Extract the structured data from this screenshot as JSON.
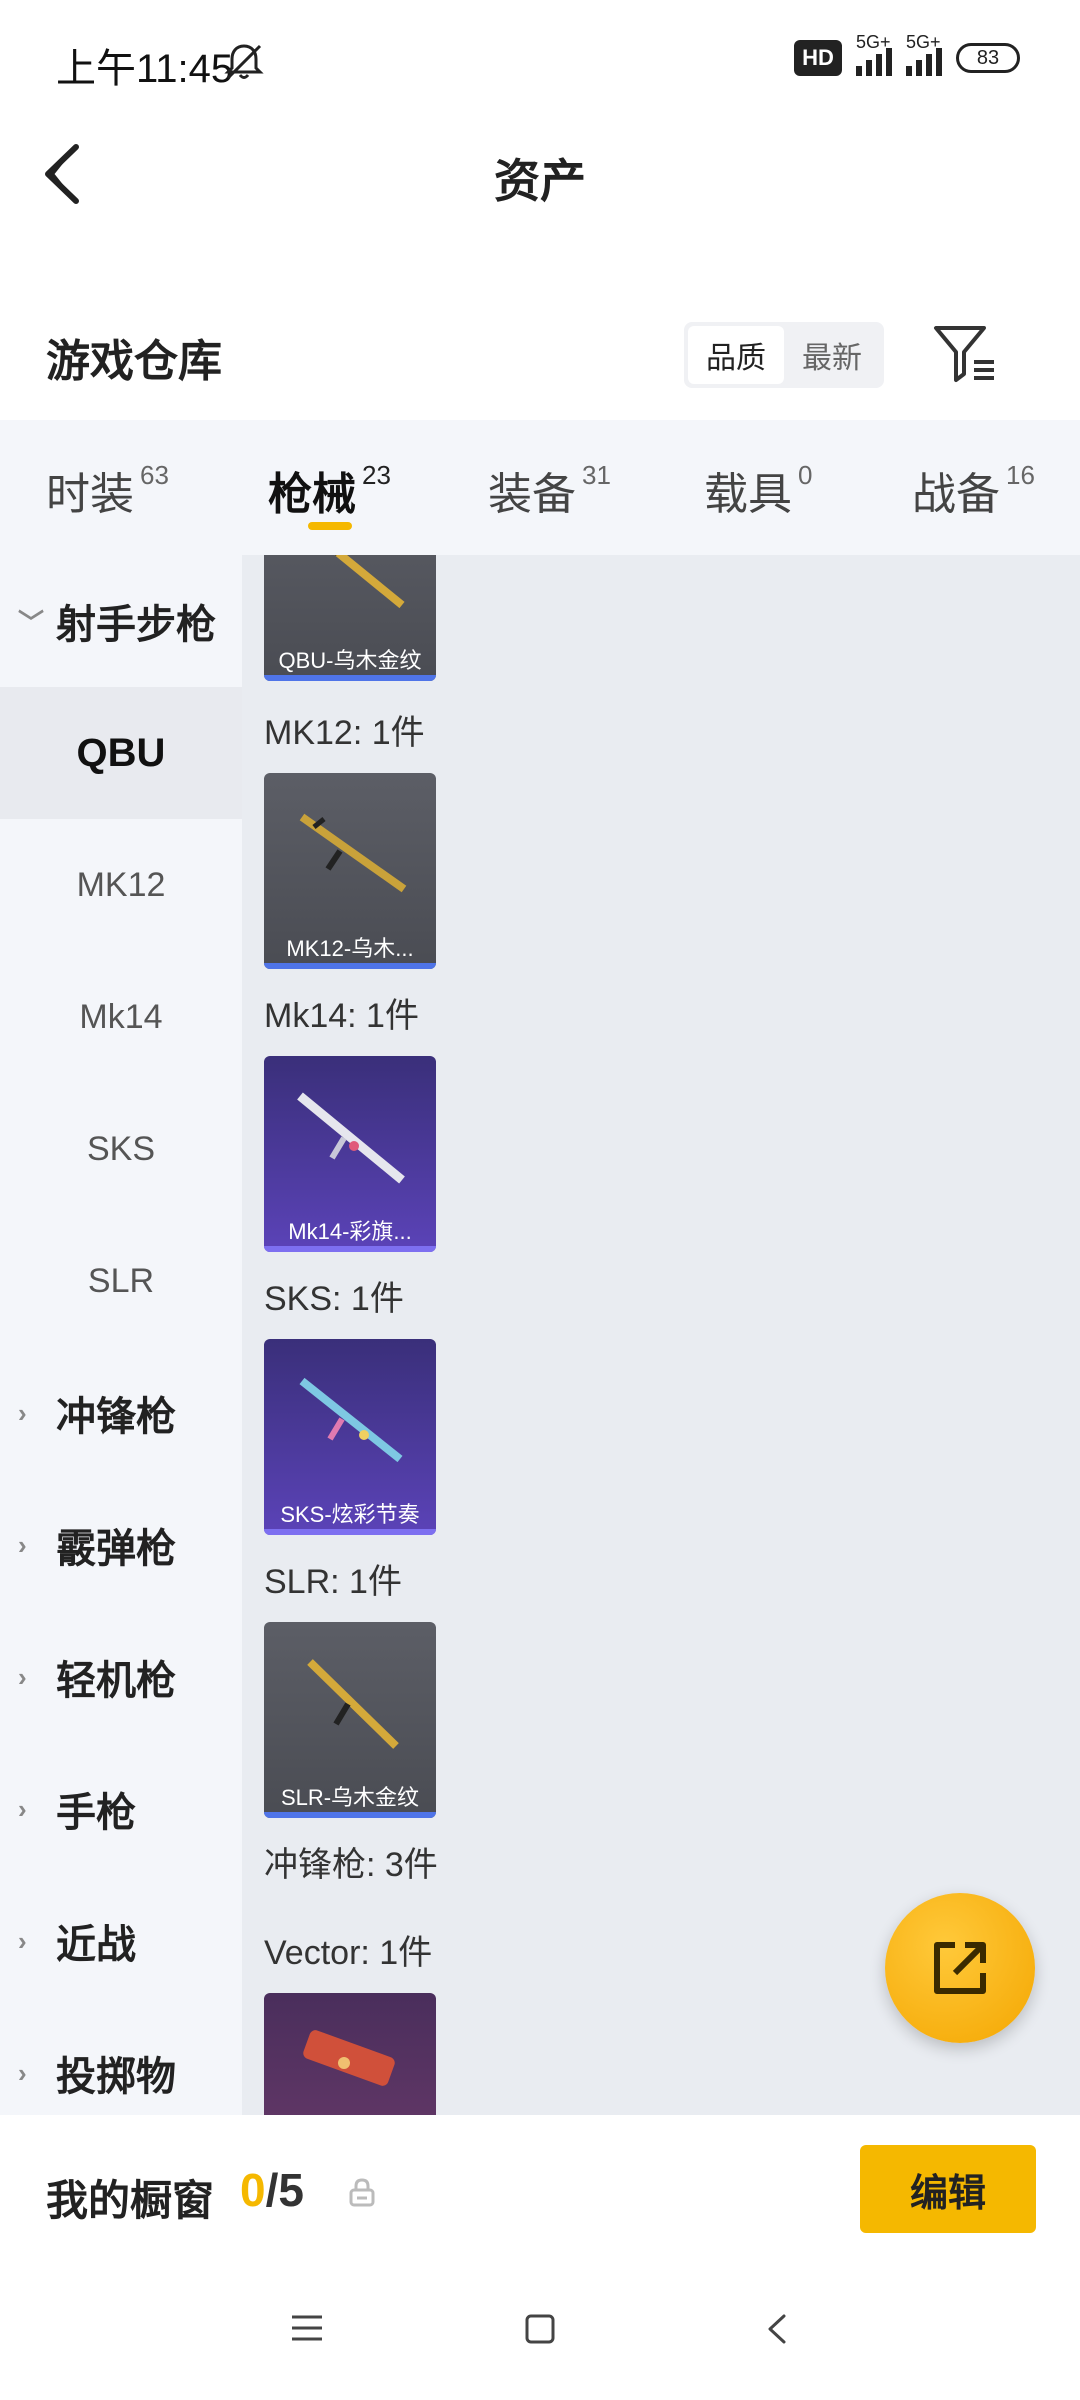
{
  "status_bar": {
    "time": "上午11:45",
    "hd_badge": "HD",
    "signal_1_label": "5G+",
    "signal_2_label": "5G+",
    "battery": "83"
  },
  "header": {
    "title": "资产"
  },
  "section": {
    "title": "游戏仓库",
    "sort_options": [
      "品质",
      "最新"
    ],
    "sort_selected": "品质"
  },
  "tabs": [
    {
      "label": "时装",
      "count": "63",
      "active": false
    },
    {
      "label": "枪械",
      "count": "23",
      "active": true
    },
    {
      "label": "装备",
      "count": "31",
      "active": false
    },
    {
      "label": "载具",
      "count": "0",
      "active": false
    },
    {
      "label": "战备",
      "count": "16",
      "active": false
    }
  ],
  "sidebar": {
    "items": [
      {
        "label": "射手步枪",
        "type": "group",
        "expanded": true
      },
      {
        "label": "QBU",
        "type": "sub",
        "active": true
      },
      {
        "label": "MK12",
        "type": "sub"
      },
      {
        "label": "Mk14",
        "type": "sub"
      },
      {
        "label": "SKS",
        "type": "sub"
      },
      {
        "label": "SLR",
        "type": "sub"
      },
      {
        "label": "冲锋枪",
        "type": "group"
      },
      {
        "label": "霰弹枪",
        "type": "group"
      },
      {
        "label": "轻机枪",
        "type": "group"
      },
      {
        "label": "手枪",
        "type": "group"
      },
      {
        "label": "近战",
        "type": "group"
      },
      {
        "label": "投掷物",
        "type": "group"
      }
    ]
  },
  "content": {
    "sections": [
      {
        "label": "",
        "item": "QBU-乌木金纹",
        "style": "gray"
      },
      {
        "label": "MK12: 1件",
        "item": "MK12-乌木...",
        "style": "gray"
      },
      {
        "label": "Mk14: 1件",
        "item": "Mk14-彩旗...",
        "style": "purple"
      },
      {
        "label": "SKS: 1件",
        "item": "SKS-炫彩节奏",
        "style": "purple"
      },
      {
        "label": "SLR: 1件",
        "item": "SLR-乌木金纹",
        "style": "gray"
      }
    ],
    "category_total": "冲锋枪: 3件",
    "vector_label": "Vector: 1件"
  },
  "bottom_bar": {
    "showcase_label": "我的橱窗",
    "showcase_current": "0",
    "showcase_total": "/5",
    "edit_label": "编辑"
  },
  "icons": {
    "back": "back-arrow-icon",
    "filter": "filter-icon",
    "share": "share-icon",
    "lock": "lock-icon",
    "mute": "mute-icon"
  },
  "colors": {
    "accent": "#f5b800",
    "tab_bg": "#f4f6fa",
    "content_bg": "#e9ecf1"
  }
}
